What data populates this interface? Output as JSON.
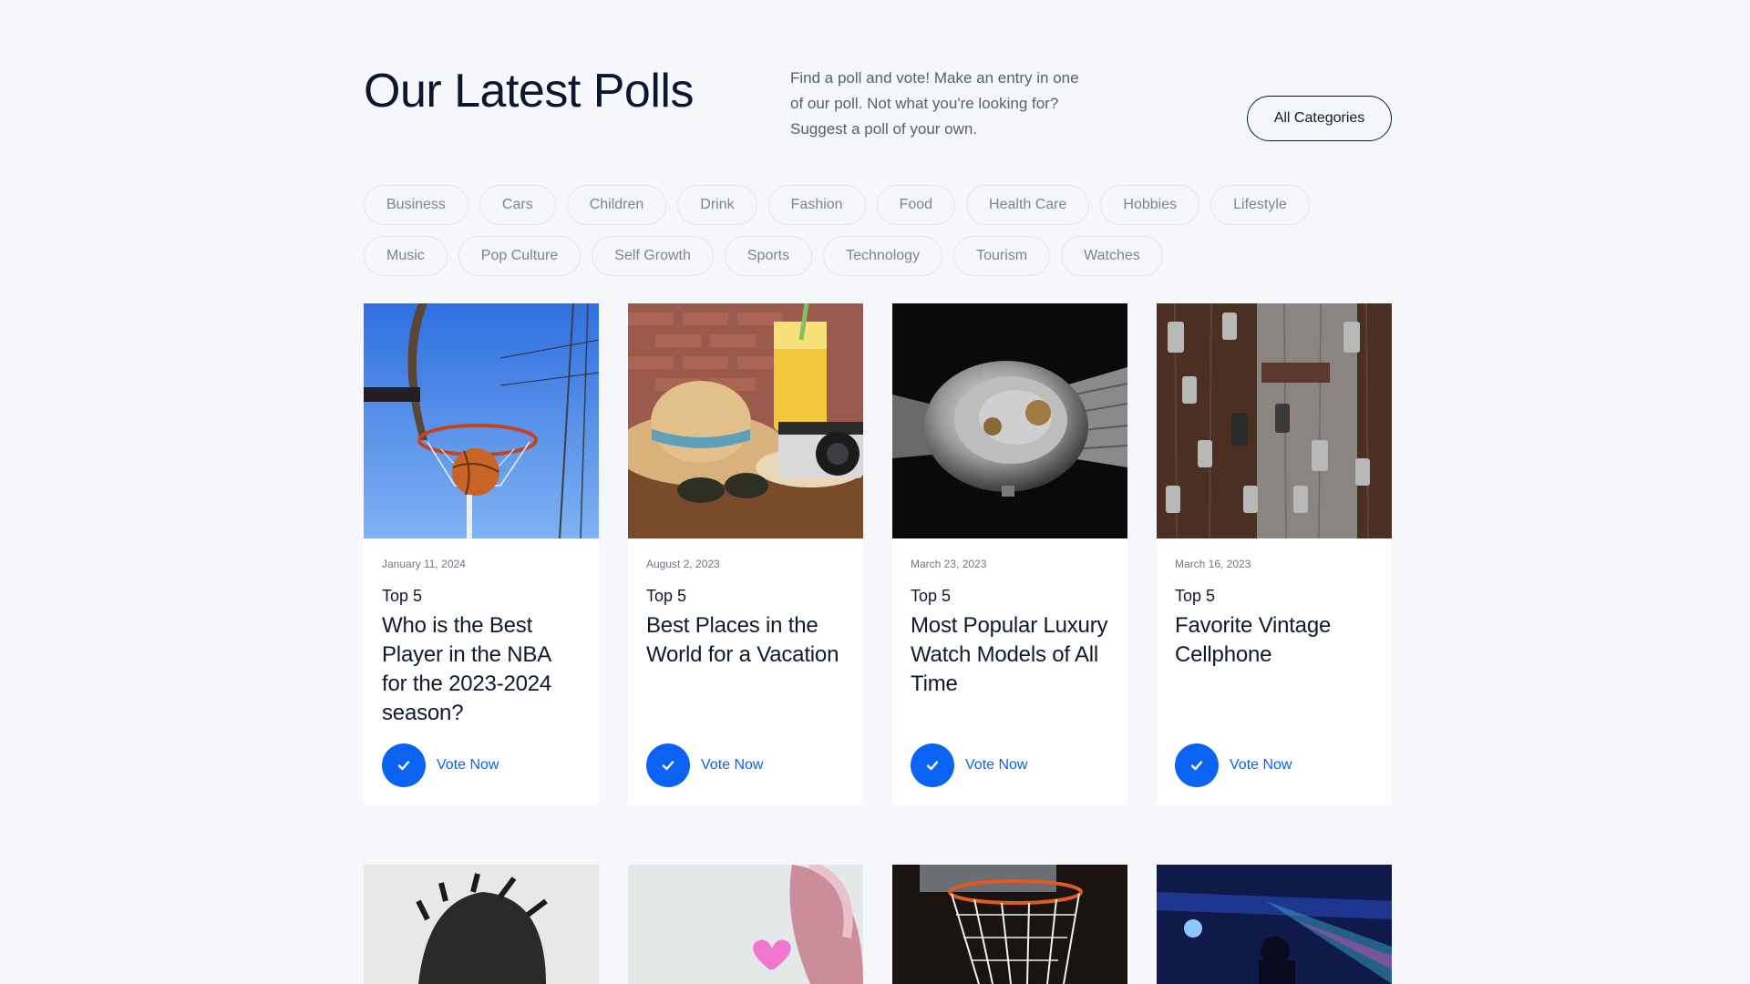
{
  "header": {
    "title": "Our Latest Polls",
    "intro": "Find a poll and vote! Make an entry in one of our poll. Not what you're looking for? Suggest a poll of your own.",
    "all_categories_label": "All Categories"
  },
  "categories": [
    "Business",
    "Cars",
    "Children",
    "Drink",
    "Fashion",
    "Food",
    "Health Care",
    "Hobbies",
    "Lifestyle",
    "Music",
    "Pop Culture",
    "Self Growth",
    "Sports",
    "Technology",
    "Tourism",
    "Watches"
  ],
  "polls": [
    {
      "date": "January 11, 2024",
      "tag": "Top 5",
      "title": "Who is the Best Player in the NBA for the 2023-2024 season?",
      "vote_label": "Vote Now",
      "image": "basketball-hoop-photo"
    },
    {
      "date": "August 2, 2023",
      "tag": "Top 5",
      "title": "Best Places in the World for a Vacation",
      "vote_label": "Vote Now",
      "image": "vacation-hat-camera-photo"
    },
    {
      "date": "March 23, 2023",
      "tag": "Top 5",
      "title": "Most Popular Luxury Watch Models of All Time",
      "vote_label": "Vote Now",
      "image": "luxury-watch-photo"
    },
    {
      "date": "March 16, 2023",
      "tag": "Top 5",
      "title": "Favorite Vintage Cellphone",
      "vote_label": "Vote Now",
      "image": "vintage-cellphones-photo"
    }
  ],
  "second_row_images": [
    "person-hair-photo",
    "pink-heart-photo",
    "basketball-net-photo",
    "concert-lights-photo"
  ],
  "colors": {
    "accent": "#0a63f2",
    "background": "#f6f7fb",
    "text": "#0f1b2d"
  },
  "icons": {
    "vote": "check-icon"
  }
}
